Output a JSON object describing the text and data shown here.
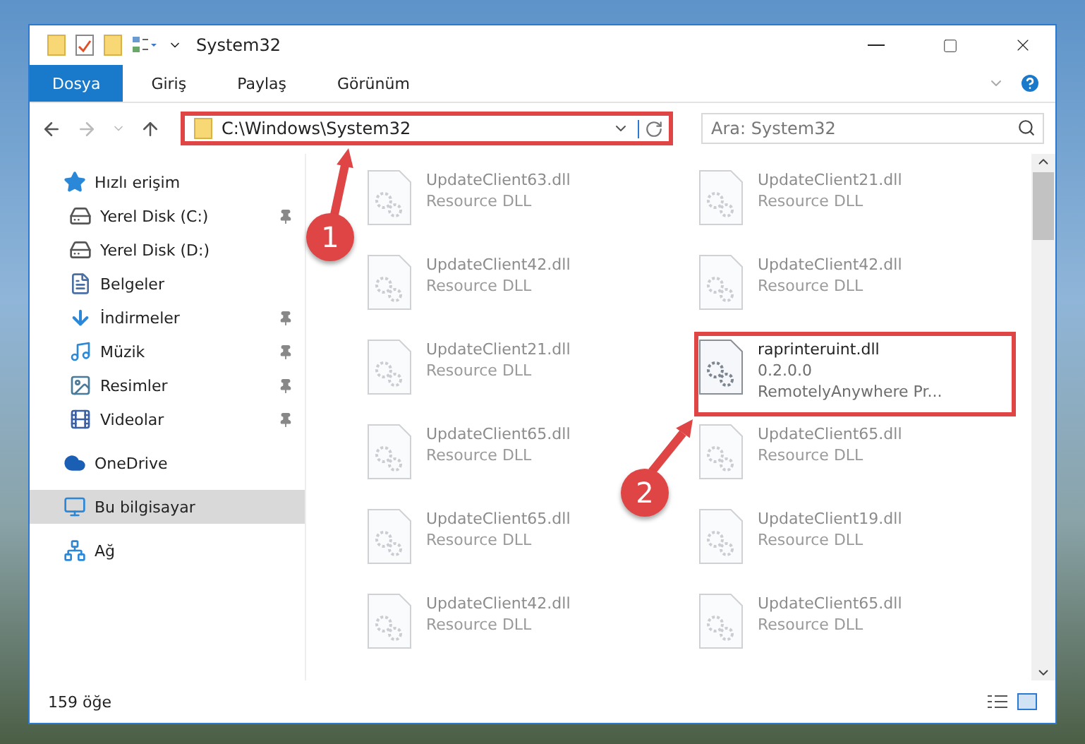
{
  "window": {
    "title": "System32"
  },
  "ribbon_tabs": [
    {
      "label": "Dosya",
      "selected": true
    },
    {
      "label": "Giriş",
      "selected": false
    },
    {
      "label": "Paylaş",
      "selected": false
    },
    {
      "label": "Görünüm",
      "selected": false
    }
  ],
  "address": {
    "path": "C:\\Windows\\System32",
    "highlighted": true
  },
  "search": {
    "placeholder": "Ara: System32"
  },
  "nav": [
    {
      "label": "Hızlı erişim",
      "kind": "star",
      "selected": false,
      "children": [
        {
          "label": "Yerel Disk (C:)",
          "kind": "drive",
          "pinned": true,
          "selected": false
        },
        {
          "label": "Yerel Disk (D:)",
          "kind": "drive",
          "pinned": false,
          "selected": false
        },
        {
          "label": "Belgeler",
          "kind": "document",
          "pinned": false,
          "selected": false
        },
        {
          "label": "İndirmeler",
          "kind": "download",
          "pinned": true,
          "selected": false
        },
        {
          "label": "Müzik",
          "kind": "music",
          "pinned": true,
          "selected": false
        },
        {
          "label": "Resimler",
          "kind": "image",
          "pinned": true,
          "selected": false
        },
        {
          "label": "Videolar",
          "kind": "film",
          "pinned": true,
          "selected": false
        }
      ]
    },
    {
      "label": "OneDrive",
      "kind": "cloud",
      "selected": false
    },
    {
      "label": "Bu bilgisayar",
      "kind": "computer",
      "selected": true
    },
    {
      "label": "Ağ",
      "kind": "network",
      "selected": false
    }
  ],
  "files": [
    {
      "name": "UpdateClient63.dll",
      "lines": [
        "Resource DLL"
      ],
      "blurred": true,
      "highlighted": false
    },
    {
      "name": "UpdateClient21.dll",
      "lines": [
        "Resource DLL"
      ],
      "blurred": true,
      "highlighted": false
    },
    {
      "name": "UpdateClient42.dll",
      "lines": [
        "Resource DLL"
      ],
      "blurred": true,
      "highlighted": false
    },
    {
      "name": "UpdateClient42.dll",
      "lines": [
        "Resource DLL"
      ],
      "blurred": true,
      "highlighted": false
    },
    {
      "name": "UpdateClient21.dll",
      "lines": [
        "Resource DLL"
      ],
      "blurred": true,
      "highlighted": false
    },
    {
      "name": "raprinteruint.dll",
      "lines": [
        "0.2.0.0",
        "RemotelyAnywhere Pr..."
      ],
      "blurred": false,
      "highlighted": true
    },
    {
      "name": "UpdateClient65.dll",
      "lines": [
        "Resource DLL"
      ],
      "blurred": true,
      "highlighted": false
    },
    {
      "name": "UpdateClient65.dll",
      "lines": [
        "Resource DLL"
      ],
      "blurred": true,
      "highlighted": false
    },
    {
      "name": "UpdateClient65.dll",
      "lines": [
        "Resource DLL"
      ],
      "blurred": true,
      "highlighted": false
    },
    {
      "name": "UpdateClient19.dll",
      "lines": [
        "Resource DLL"
      ],
      "blurred": true,
      "highlighted": false
    },
    {
      "name": "UpdateClient42.dll",
      "lines": [
        "Resource DLL"
      ],
      "blurred": true,
      "highlighted": false
    },
    {
      "name": "UpdateClient65.dll",
      "lines": [
        "Resource DLL"
      ],
      "blurred": true,
      "highlighted": false
    }
  ],
  "status_bar": {
    "count": "159 öğe"
  },
  "annotations": [
    {
      "label": "1"
    },
    {
      "label": "2"
    }
  ]
}
